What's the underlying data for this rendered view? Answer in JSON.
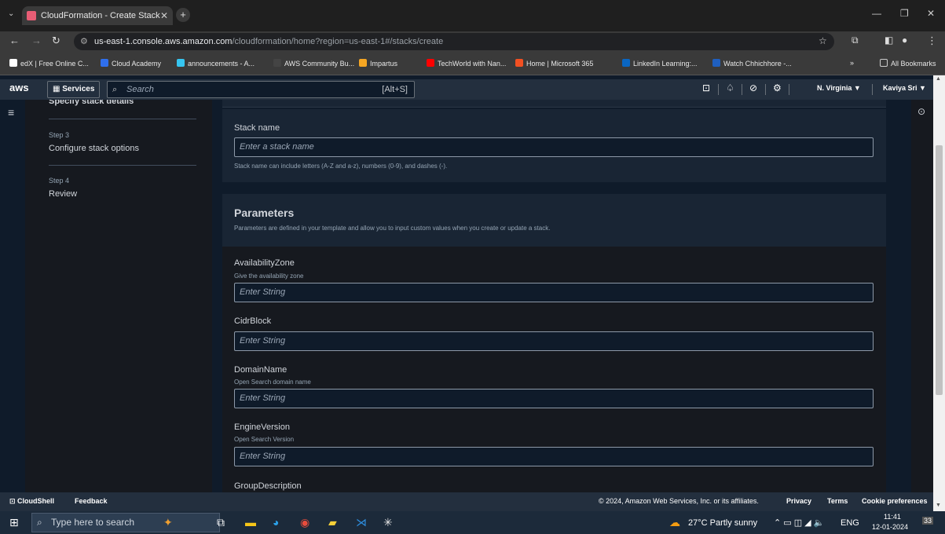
{
  "browser": {
    "tab_title": "CloudFormation - Create Stack",
    "tab_close": "✕",
    "new_tab": "+",
    "url_host": "us-east-1.console.aws.amazon.com",
    "url_path": "/cloudformation/home?region=us-east-1#/stacks/create",
    "bookmarks": [
      {
        "label": "edX | Free Online C...",
        "color": "#ffffff"
      },
      {
        "label": "Cloud Academy",
        "color": "#2f6fed"
      },
      {
        "label": "announcements - A...",
        "color": "#36c5f0"
      },
      {
        "label": "AWS Community Bu...",
        "color": "#444444"
      },
      {
        "label": "Impartus",
        "color": "#f5a623"
      },
      {
        "label": "TechWorld with Nan...",
        "color": "#ff0000"
      },
      {
        "label": "Home | Microsoft 365",
        "color": "#f25022"
      },
      {
        "label": "LinkedIn Learning:...",
        "color": "#0a66c2"
      },
      {
        "label": "Watch Chhichhore -...",
        "color": "#1f5fbf"
      }
    ],
    "bookmarks_more": "»",
    "all_bookmarks": "All Bookmarks"
  },
  "aws_nav": {
    "logo": "aws",
    "services": "Services",
    "search_placeholder": "Search",
    "search_shortcut": "[Alt+S]",
    "region": "N. Virginia ▼",
    "user": "Kaviya Sri ▼"
  },
  "wizard": {
    "prev_step_partial": "Specify stack details",
    "steps": [
      {
        "num": "Step 3",
        "title": "Configure stack options"
      },
      {
        "num": "Step 4",
        "title": "Review"
      }
    ]
  },
  "stack_name": {
    "label": "Stack name",
    "placeholder": "Enter a stack name",
    "hint": "Stack name can include letters (A-Z and a-z), numbers (0-9), and dashes (-)."
  },
  "parameters": {
    "heading": "Parameters",
    "description": "Parameters are defined in your template and allow you to input custom values when you create or update a stack.",
    "fields": [
      {
        "label": "AvailabilityZone",
        "desc": "Give the availability zone",
        "placeholder": "Enter String"
      },
      {
        "label": "CidrBlock",
        "desc": "",
        "placeholder": "Enter String"
      },
      {
        "label": "DomainName",
        "desc": "Open Search domain name",
        "placeholder": "Enter String"
      },
      {
        "label": "EngineVersion",
        "desc": "Open Search Version",
        "placeholder": "Enter String"
      },
      {
        "label": "GroupDescription",
        "desc": "",
        "placeholder": ""
      }
    ]
  },
  "footer": {
    "cloudshell": "CloudShell",
    "feedback": "Feedback",
    "copyright": "© 2024, Amazon Web Services, Inc. or its affiliates.",
    "privacy": "Privacy",
    "terms": "Terms",
    "cookies": "Cookie preferences"
  },
  "taskbar": {
    "search_placeholder": "Type here to search",
    "weather": "27°C Partly sunny",
    "lang": "ENG",
    "time": "11:41",
    "date": "12-01-2024",
    "notifications": "33"
  }
}
